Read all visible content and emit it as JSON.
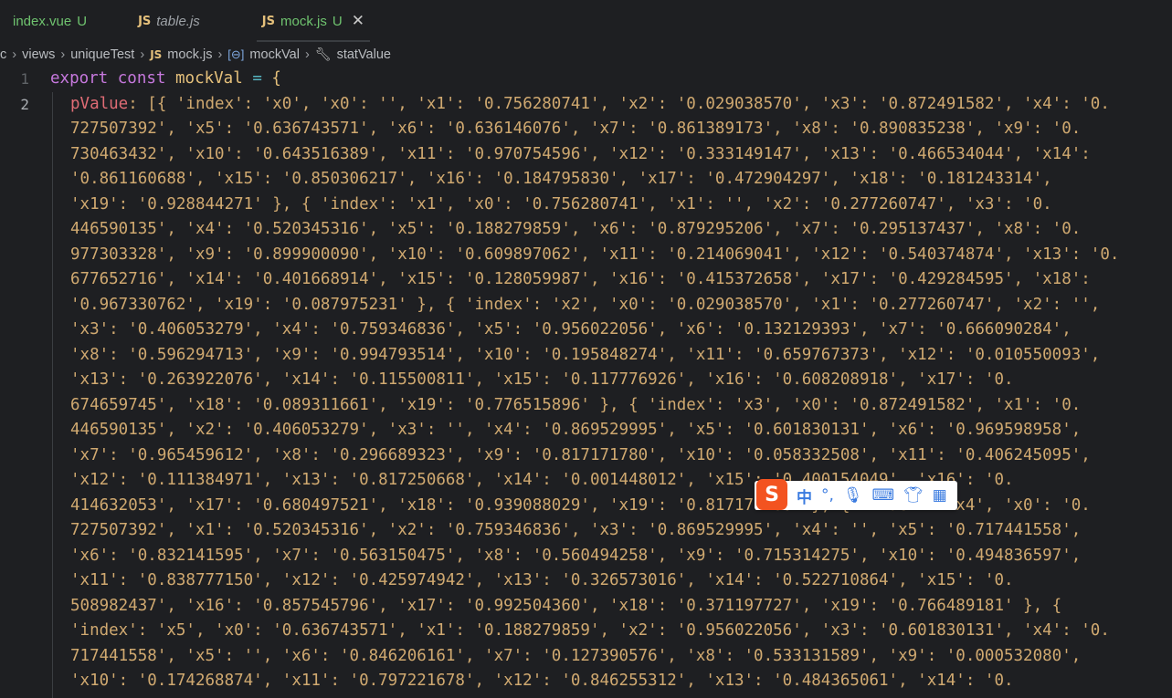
{
  "tabs": [
    {
      "name": "index.vue",
      "status": "U"
    },
    {
      "icon": "JS",
      "name": "table.js"
    },
    {
      "icon": "JS",
      "name": "mock.js",
      "status": "U",
      "close": "✕"
    }
  ],
  "breadcrumb": {
    "lead": "c",
    "items": [
      "views",
      "uniqueTest",
      "mock.js",
      "mockVal",
      "statValue"
    ],
    "js_icon": "JS"
  },
  "editor": {
    "line_numbers": [
      "1",
      "2"
    ],
    "line1": {
      "kw1": "export",
      "kw2": "const",
      "name": "mockVal",
      "op": "=",
      "brace": "{"
    },
    "prop": "pValue",
    "wrapped_lines": [
      "pValue: [{ 'index': 'x0', 'x0': '', 'x1': '0.756280741', 'x2': '0.029038570', 'x3': '0.872491582', 'x4': '0.",
      "727507392', 'x5': '0.636743571', 'x6': '0.636146076', 'x7': '0.861389173', 'x8': '0.890835238', 'x9': '0.",
      "730463432', 'x10': '0.643516389', 'x11': '0.970754596', 'x12': '0.333149147', 'x13': '0.466534044', 'x14':",
      "'0.861160688', 'x15': '0.850306217', 'x16': '0.184795830', 'x17': '0.472904297', 'x18': '0.181243314',",
      "'x19': '0.928844271' }, { 'index': 'x1', 'x0': '0.756280741', 'x1': '', 'x2': '0.277260747', 'x3': '0.",
      "446590135', 'x4': '0.520345316', 'x5': '0.188279859', 'x6': '0.879295206', 'x7': '0.295137437', 'x8': '0.",
      "977303328', 'x9': '0.899900090', 'x10': '0.609897062', 'x11': '0.214069041', 'x12': '0.540374874', 'x13': '0.",
      "677652716', 'x14': '0.401668914', 'x15': '0.128059987', 'x16': '0.415372658', 'x17': '0.429284595', 'x18':",
      "'0.967330762', 'x19': '0.087975231' }, { 'index': 'x2', 'x0': '0.029038570', 'x1': '0.277260747', 'x2': '',",
      "'x3': '0.406053279', 'x4': '0.759346836', 'x5': '0.956022056', 'x6': '0.132129393', 'x7': '0.666090284',",
      "'x8': '0.596294713', 'x9': '0.994793514', 'x10': '0.195848274', 'x11': '0.659767373', 'x12': '0.010550093',",
      "'x13': '0.263922076', 'x14': '0.115500811', 'x15': '0.117776926', 'x16': '0.608208918', 'x17': '0.",
      "674659745', 'x18': '0.089311661', 'x19': '0.776515896' }, { 'index': 'x3', 'x0': '0.872491582', 'x1': '0.",
      "446590135', 'x2': '0.406053279', 'x3': '', 'x4': '0.869529995', 'x5': '0.601830131', 'x6': '0.969598958',",
      "'x7': '0.965459612', 'x8': '0.296689323', 'x9': '0.817171780', 'x10': '0.058332508', 'x11': '0.406245095',",
      "'x12': '0.111384971', 'x13': '0.817250668', 'x14': '0.001448012', 'x15': '0.400154049', 'x16': '0.",
      "414632053', 'x17': '0.680497521', 'x18': '0.939088029', 'x19': '0.817171780' }, { 'index': 'x4', 'x0': '0.",
      "727507392', 'x1': '0.520345316', 'x2': '0.759346836', 'x3': '0.869529995', 'x4': '', 'x5': '0.717441558',",
      "'x6': '0.832141595', 'x7': '0.563150475', 'x8': '0.560494258', 'x9': '0.715314275', 'x10': '0.494836597',",
      "'x11': '0.838777150', 'x12': '0.425974942', 'x13': '0.326573016', 'x14': '0.522710864', 'x15': '0.",
      "508982437', 'x16': '0.857545796', 'x17': '0.992504360', 'x18': '0.371197727', 'x19': '0.766489181' }, {",
      "'index': 'x5', 'x0': '0.636743571', 'x1': '0.188279859', 'x2': '0.956022056', 'x3': '0.601830131', 'x4': '0.",
      "717441558', 'x5': '', 'x6': '0.846206161', 'x7': '0.127390576', 'x8': '0.533131589', 'x9': '0.000532080',",
      "'x10': '0.174268874', 'x11': '0.797221678', 'x12': '0.846255312', 'x13': '0.484365061', 'x14': '0."
    ]
  },
  "ime": {
    "logo": "S",
    "lang": "中",
    "punct": "°,",
    "icons": [
      "mic-icon",
      "keyboard-icon",
      "skin-icon",
      "toolbox-icon"
    ]
  }
}
